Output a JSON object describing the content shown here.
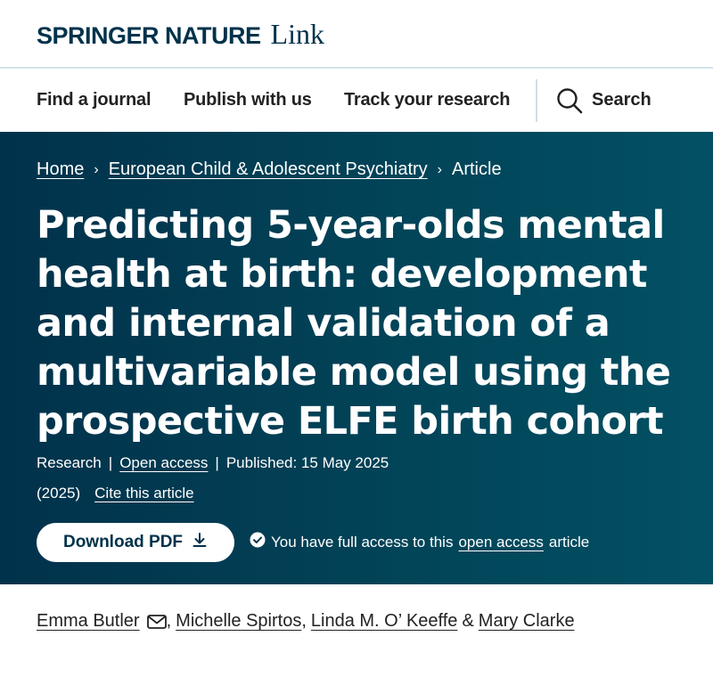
{
  "brand": {
    "primary": "SPRINGER NATURE",
    "secondary": "Link",
    "color": "#01324b"
  },
  "nav": {
    "items": [
      "Find a journal",
      "Publish with us",
      "Track your research"
    ],
    "search_label": "Search",
    "search_icon": "search-icon"
  },
  "breadcrumb": {
    "items": [
      "Home",
      "European Child & Adolescent Psychiatry",
      "Article"
    ],
    "separator": "›"
  },
  "article": {
    "title": "Predicting 5-year-olds mental health at birth: development and internal validation of a multivariable model using the prospective ELFE birth cohort",
    "type": "Research",
    "access": "Open access",
    "published": "Published: 15 May 2025",
    "year": "(2025)",
    "cite_label": "Cite this article"
  },
  "actions": {
    "download_label": "Download PDF",
    "download_icon": "download-icon",
    "access_note_prefix": "You have full access to this",
    "access_note_link": "open access",
    "access_note_suffix": "article"
  },
  "authors": {
    "names": [
      "Emma Butler",
      "Michelle Spirtos",
      "Linda M. O’ Keeffe",
      "Mary Clarke"
    ],
    "comma": ",",
    "ampersand": "&",
    "corresponding_icon": "mail-icon"
  },
  "colors": {
    "hero_dark": "#01324b",
    "hero_light": "#035064"
  }
}
